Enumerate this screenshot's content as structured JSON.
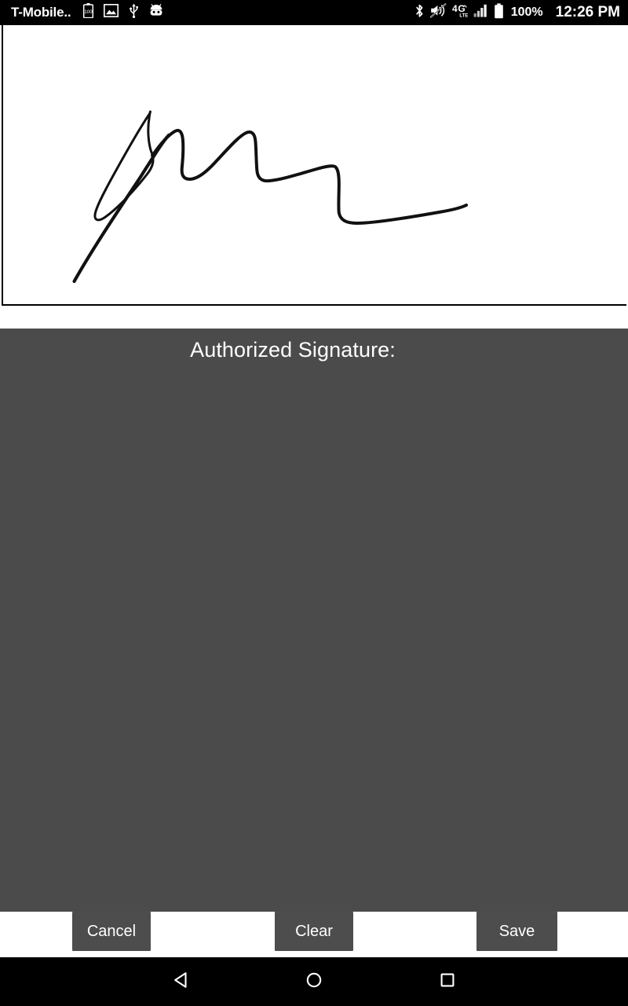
{
  "status_bar": {
    "carrier": "T-Mobile..",
    "left_icons": [
      {
        "name": "battery-saver-icon",
        "label": "100"
      },
      {
        "name": "photo-icon",
        "label": ""
      },
      {
        "name": "usb-icon",
        "label": ""
      },
      {
        "name": "android-robot-icon",
        "label": ""
      }
    ],
    "right_icons": [
      {
        "name": "bluetooth-icon"
      },
      {
        "name": "volume-mute-icon"
      },
      {
        "name": "network-4g-lte-icon"
      },
      {
        "name": "signal-bars-icon"
      },
      {
        "name": "battery-full-icon"
      }
    ],
    "battery_percent": "100%",
    "clock": "12:26 PM",
    "background_color": "#000000",
    "text_color": "#ffffff"
  },
  "signature_pad": {
    "name": "signature-canvas",
    "background_color": "#ffffff",
    "ink_color": "#111111",
    "border_color": "#000000",
    "has_signature": true
  },
  "content": {
    "label": "Authorized Signature:",
    "background_color": "#4b4b4b",
    "text_color": "#ffffff"
  },
  "action_bar": {
    "background_color": "#ffffff",
    "button_color": "#4d4d4d",
    "buttons": [
      {
        "name": "cancel-button",
        "label": "Cancel"
      },
      {
        "name": "clear-button",
        "label": "Clear"
      },
      {
        "name": "save-button",
        "label": "Save"
      }
    ]
  },
  "nav_bar": {
    "background_color": "#000000",
    "buttons": [
      {
        "name": "nav-back-button",
        "icon": "back-triangle-icon"
      },
      {
        "name": "nav-home-button",
        "icon": "home-circle-icon"
      },
      {
        "name": "nav-recents-button",
        "icon": "recents-square-icon"
      }
    ]
  }
}
